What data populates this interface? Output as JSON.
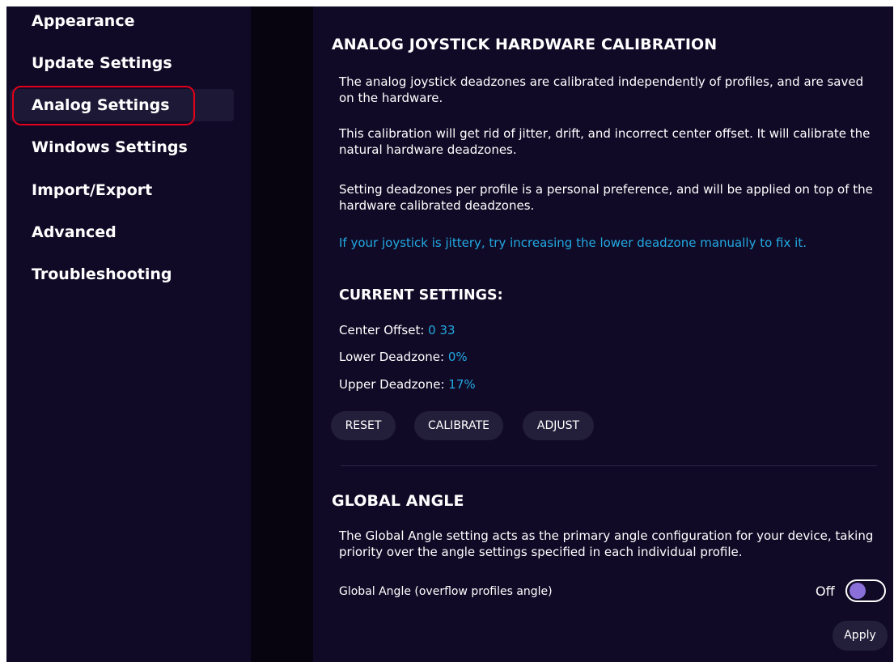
{
  "sidebar": {
    "items": [
      {
        "label": "Appearance"
      },
      {
        "label": "Update Settings"
      },
      {
        "label": "Analog Settings"
      },
      {
        "label": "Windows Settings"
      },
      {
        "label": "Import/Export"
      },
      {
        "label": "Advanced"
      },
      {
        "label": "Troubleshooting"
      }
    ]
  },
  "analog": {
    "title": "ANALOG JOYSTICK HARDWARE CALIBRATION",
    "para1": "The analog joystick deadzones are calibrated independently of profiles, and are saved on the hardware.",
    "para2": "This calibration will get rid of jitter, drift, and incorrect center offset. It will calibrate the natural hardware deadzones.",
    "para3": "Setting deadzones per profile is a personal preference, and will be applied on top of the hardware calibrated deadzones.",
    "tip": "If your joystick is jittery, try increasing the lower deadzone manually to fix it.",
    "current_heading": "CURRENT SETTINGS:",
    "center_offset": {
      "label": "Center Offset: ",
      "value": "0 33"
    },
    "lower_deadzone": {
      "label": "Lower Deadzone: ",
      "value": "0%"
    },
    "upper_deadzone": {
      "label": "Upper Deadzone: ",
      "value": "17%"
    },
    "buttons": {
      "reset": "RESET",
      "calibrate": "CALIBRATE",
      "adjust": "ADJUST"
    }
  },
  "global_angle": {
    "title": "GLOBAL ANGLE",
    "description": "The Global Angle setting acts as the primary angle configuration for your device, taking priority over the angle settings specified in each individual profile.",
    "toggle_label": "Global Angle (overflow profiles angle)",
    "toggle_state": "Off",
    "apply": "Apply"
  },
  "colors": {
    "background": "#100a26",
    "accent": "#22a9e2",
    "button_bg": "#231e3a",
    "toggle_knob": "#8a6fd8",
    "highlight_ring": "#e4001b"
  }
}
